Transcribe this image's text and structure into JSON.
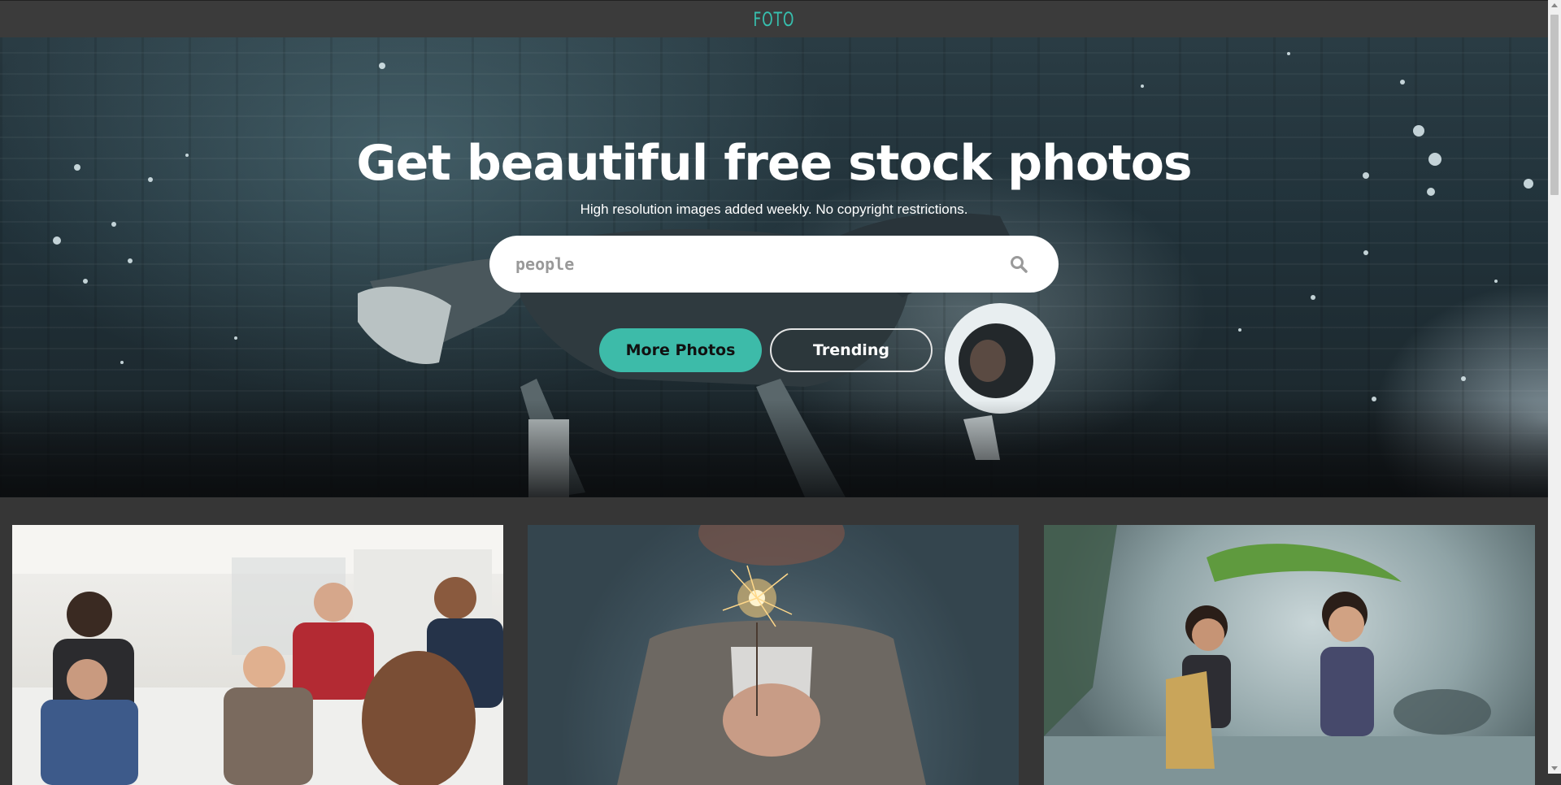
{
  "header": {
    "brand": "FOTO"
  },
  "hero": {
    "title": "Get beautiful free stock photos",
    "subtitle": "High resolution images added weekly. No copyright restrictions.",
    "search": {
      "value": "people",
      "icon": "search-icon"
    },
    "buttons": {
      "more_photos": "More Photos",
      "trending": "Trending"
    }
  },
  "gallery": {
    "photos": [
      {
        "subject": "team-meeting-photo"
      },
      {
        "subject": "sparkler-photo"
      },
      {
        "subject": "kids-in-rain-photo"
      }
    ]
  },
  "colors": {
    "accent": "#3dbba9",
    "brand": "#37bfae",
    "background": "#363636"
  }
}
